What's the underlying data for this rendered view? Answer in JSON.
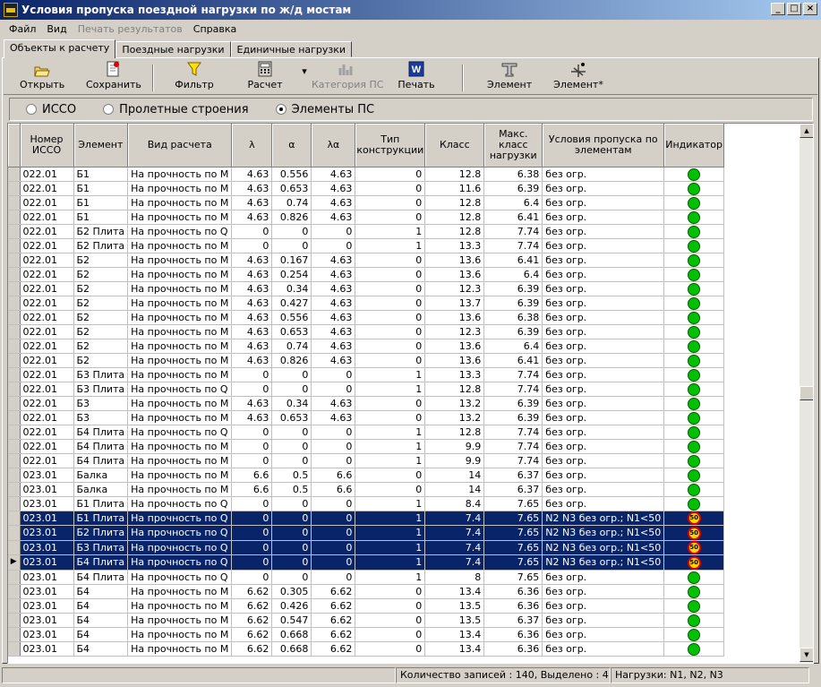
{
  "window": {
    "title": "Условия пропуска поездной нагрузки по ж/д мостам",
    "min": "_",
    "max": "□",
    "close": "×"
  },
  "menu": {
    "file": "Файл",
    "view": "Вид",
    "print_results": "Печать результатов",
    "help": "Справка"
  },
  "tabs": [
    "Объекты к расчету",
    "Поездные нагрузки",
    "Единичные нагрузки"
  ],
  "toolbar": {
    "open": "Открыть",
    "save": "Сохранить",
    "filter": "Фильтр",
    "calc": "Расчет",
    "category": "Категория ПС",
    "print": "Печать",
    "element": "Элемент",
    "element_star": "Элемент*",
    "dropdown": "▾"
  },
  "radios": {
    "isso": "ИССО",
    "spans": "Пролетные строения",
    "elements": "Элементы ПС"
  },
  "columns": [
    "Номер ИССО",
    "Элемент",
    "Вид расчета",
    "λ",
    "α",
    "λα",
    "Тип конструкции",
    "Класс",
    "Макс. класс нагрузки",
    "Условия пропуска по элементам",
    "Индикатор"
  ],
  "rows": [
    [
      "022.01",
      "Б1",
      "На прочность по М",
      "4.63",
      "0.556",
      "4.63",
      "0",
      "12.8",
      "6.38",
      "без огр."
    ],
    [
      "022.01",
      "Б1",
      "На прочность по М",
      "4.63",
      "0.653",
      "4.63",
      "0",
      "11.6",
      "6.39",
      "без огр."
    ],
    [
      "022.01",
      "Б1",
      "На прочность по М",
      "4.63",
      "0.74",
      "4.63",
      "0",
      "12.8",
      "6.4",
      "без огр."
    ],
    [
      "022.01",
      "Б1",
      "На прочность по М",
      "4.63",
      "0.826",
      "4.63",
      "0",
      "12.8",
      "6.41",
      "без огр."
    ],
    [
      "022.01",
      "Б2 Плита",
      "На прочность по Q",
      "0",
      "0",
      "0",
      "1",
      "12.8",
      "7.74",
      "без огр."
    ],
    [
      "022.01",
      "Б2 Плита",
      "На прочность по М",
      "0",
      "0",
      "0",
      "1",
      "13.3",
      "7.74",
      "без огр."
    ],
    [
      "022.01",
      "Б2",
      "На прочность по М",
      "4.63",
      "0.167",
      "4.63",
      "0",
      "13.6",
      "6.41",
      "без огр."
    ],
    [
      "022.01",
      "Б2",
      "На прочность по М",
      "4.63",
      "0.254",
      "4.63",
      "0",
      "13.6",
      "6.4",
      "без огр."
    ],
    [
      "022.01",
      "Б2",
      "На прочность по М",
      "4.63",
      "0.34",
      "4.63",
      "0",
      "12.3",
      "6.39",
      "без огр."
    ],
    [
      "022.01",
      "Б2",
      "На прочность по М",
      "4.63",
      "0.427",
      "4.63",
      "0",
      "13.7",
      "6.39",
      "без огр."
    ],
    [
      "022.01",
      "Б2",
      "На прочность по М",
      "4.63",
      "0.556",
      "4.63",
      "0",
      "13.6",
      "6.38",
      "без огр."
    ],
    [
      "022.01",
      "Б2",
      "На прочность по М",
      "4.63",
      "0.653",
      "4.63",
      "0",
      "12.3",
      "6.39",
      "без огр."
    ],
    [
      "022.01",
      "Б2",
      "На прочность по М",
      "4.63",
      "0.74",
      "4.63",
      "0",
      "13.6",
      "6.4",
      "без огр."
    ],
    [
      "022.01",
      "Б2",
      "На прочность по М",
      "4.63",
      "0.826",
      "4.63",
      "0",
      "13.6",
      "6.41",
      "без огр."
    ],
    [
      "022.01",
      "Б3 Плита",
      "На прочность по М",
      "0",
      "0",
      "0",
      "1",
      "13.3",
      "7.74",
      "без огр."
    ],
    [
      "022.01",
      "Б3 Плита",
      "На прочность по Q",
      "0",
      "0",
      "0",
      "1",
      "12.8",
      "7.74",
      "без огр."
    ],
    [
      "022.01",
      "Б3",
      "На прочность по М",
      "4.63",
      "0.34",
      "4.63",
      "0",
      "13.2",
      "6.39",
      "без огр."
    ],
    [
      "022.01",
      "Б3",
      "На прочность по М",
      "4.63",
      "0.653",
      "4.63",
      "0",
      "13.2",
      "6.39",
      "без огр."
    ],
    [
      "022.01",
      "Б4 Плита",
      "На прочность по Q",
      "0",
      "0",
      "0",
      "1",
      "12.8",
      "7.74",
      "без огр."
    ],
    [
      "022.01",
      "Б4 Плита",
      "На прочность по М",
      "0",
      "0",
      "0",
      "1",
      "9.9",
      "7.74",
      "без огр."
    ],
    [
      "022.01",
      "Б4 Плита",
      "На прочность по М",
      "0",
      "0",
      "0",
      "1",
      "9.9",
      "7.74",
      "без огр."
    ],
    [
      "023.01",
      "Балка",
      "На прочность по М",
      "6.6",
      "0.5",
      "6.6",
      "0",
      "14",
      "6.37",
      "без огр."
    ],
    [
      "023.01",
      "Балка",
      "На прочность по М",
      "6.6",
      "0.5",
      "6.6",
      "0",
      "14",
      "6.37",
      "без огр."
    ],
    [
      "023.01",
      "Б1 Плита",
      "На прочность по Q",
      "0",
      "0",
      "0",
      "1",
      "8.4",
      "7.65",
      "без огр."
    ],
    [
      "023.01",
      "Б1 Плита",
      "На прочность по Q",
      "0",
      "0",
      "0",
      "1",
      "7.4",
      "7.65",
      "N2 N3  без огр.; N1<50"
    ],
    [
      "023.01",
      "Б2 Плита",
      "На прочность по Q",
      "0",
      "0",
      "0",
      "1",
      "7.4",
      "7.65",
      "N2 N3  без огр.; N1<50"
    ],
    [
      "023.01",
      "Б3 Плита",
      "На прочность по Q",
      "0",
      "0",
      "0",
      "1",
      "7.4",
      "7.65",
      "N2 N3  без огр.; N1<50"
    ],
    [
      "023.01",
      "Б4 Плита",
      "На прочность по Q",
      "0",
      "0",
      "0",
      "1",
      "7.4",
      "7.65",
      "N2 N3  без огр.; N1<50"
    ],
    [
      "023.01",
      "Б4 Плита",
      "На прочность по Q",
      "0",
      "0",
      "0",
      "1",
      "8",
      "7.65",
      "без огр."
    ],
    [
      "023.01",
      "Б4",
      "На прочность по М",
      "6.62",
      "0.305",
      "6.62",
      "0",
      "13.4",
      "6.36",
      "без огр."
    ],
    [
      "023.01",
      "Б4",
      "На прочность по М",
      "6.62",
      "0.426",
      "6.62",
      "0",
      "13.5",
      "6.36",
      "без огр."
    ],
    [
      "023.01",
      "Б4",
      "На прочность по М",
      "6.62",
      "0.547",
      "6.62",
      "0",
      "13.5",
      "6.37",
      "без огр."
    ],
    [
      "023.01",
      "Б4",
      "На прочность по М",
      "6.62",
      "0.668",
      "6.62",
      "0",
      "13.4",
      "6.36",
      "без огр."
    ],
    [
      "023.01",
      "Б4",
      "На прочность по М",
      "6.62",
      "0.668",
      "6.62",
      "0",
      "13.4",
      "6.36",
      "без огр."
    ]
  ],
  "selected_rows": [
    24,
    25,
    26,
    27
  ],
  "current_row": 27,
  "warn_label": "50",
  "row_marker": "▶",
  "scroll": {
    "up": "▲",
    "down": "▼"
  },
  "status": {
    "records": "Количество записей : 140,  Выделено : 4",
    "loads": "Нагрузки: N1, N2, N3"
  },
  "colors": {
    "selection": "#0a246a",
    "ok": "#00c000",
    "warn": "#ffd400"
  }
}
